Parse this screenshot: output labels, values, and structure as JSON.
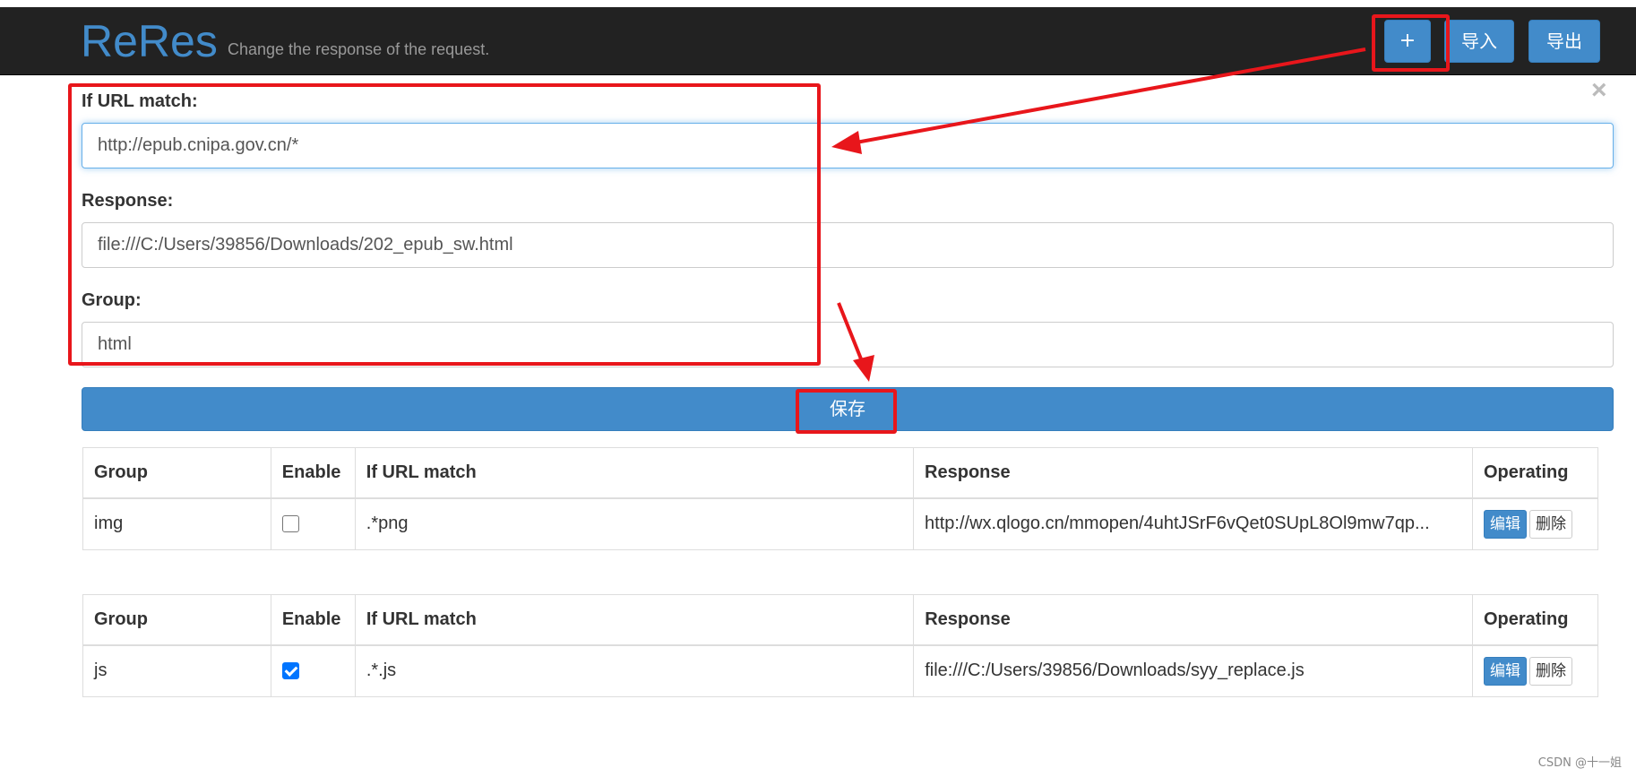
{
  "navbar": {
    "brand": "ReRes",
    "tagline": "Change the response of the request.",
    "add_label": "+",
    "import_label": "导入",
    "export_label": "导出"
  },
  "form": {
    "close_label": "×",
    "url_label": "If URL match:",
    "url_value": "http://epub.cnipa.gov.cn/*",
    "response_label": "Response:",
    "response_value": "file:///C:/Users/39856/Downloads/202_epub_sw.html",
    "group_label": "Group:",
    "group_value": "html",
    "save_label": "保存"
  },
  "tables": [
    {
      "headers": [
        "Group",
        "Enable",
        "If URL match",
        "Response",
        "Operating"
      ],
      "rows": [
        {
          "group": "img",
          "enabled": false,
          "url": ".*png",
          "response": "http://wx.qlogo.cn/mmopen/4uhtJSrF6vQet0SUpL8Ol9mw7qp...",
          "edit_label": "编辑",
          "delete_label": "删除"
        }
      ]
    },
    {
      "headers": [
        "Group",
        "Enable",
        "If URL match",
        "Response",
        "Operating"
      ],
      "rows": [
        {
          "group": "js",
          "enabled": true,
          "url": ".*.js",
          "response": "file:///C:/Users/39856/Downloads/syy_replace.js",
          "edit_label": "编辑",
          "delete_label": "删除"
        }
      ]
    }
  ],
  "watermark": "CSDN @十一姐",
  "colors": {
    "primary": "#428bca",
    "navbar_bg": "#222222",
    "annotation_red": "#e8161b"
  }
}
